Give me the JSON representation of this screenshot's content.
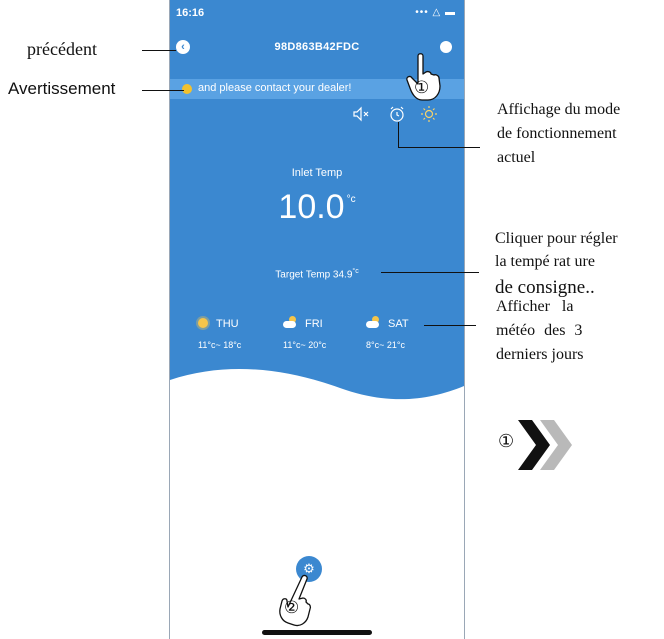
{
  "phone": {
    "status_time": "16:16",
    "status_icons": "••• △ ▬",
    "back_glyph": "‹",
    "device_id": "98D863B42FDC",
    "warning_text": "and please contact your dealer!",
    "inlet_label": "Inlet Temp",
    "inlet_value": "10.0",
    "inlet_unit": "°c",
    "target_label": "Target Temp",
    "target_value": "34.9",
    "target_unit": "°c",
    "forecast": [
      {
        "day": "THU",
        "range": "11°c~ 18°c",
        "icon": "sun-icon"
      },
      {
        "day": "FRI",
        "range": "11°c~ 20°c",
        "icon": "partly-cloudy-icon"
      },
      {
        "day": "SAT",
        "range": "8°c~ 21°c",
        "icon": "partly-cloudy-icon"
      }
    ],
    "accent": "#3b88d0",
    "warning_bar_color": "#5aa2e3"
  },
  "annotations": {
    "precedent": "précédent",
    "avertissement": "Avertissement",
    "mode_line1": "Affichage du mode",
    "mode_line2": "de fonctionnement",
    "mode_line3": "actuel",
    "target_line1": "Cliquer pour régler",
    "target_line2": "la tempé rat ure",
    "target_line3": "de consigne..",
    "weather_line1": "Afficher la",
    "weather_line2": "météo des 3",
    "weather_line3": "derniers jours",
    "step1": "①",
    "step2": "②",
    "next_step": "①"
  }
}
